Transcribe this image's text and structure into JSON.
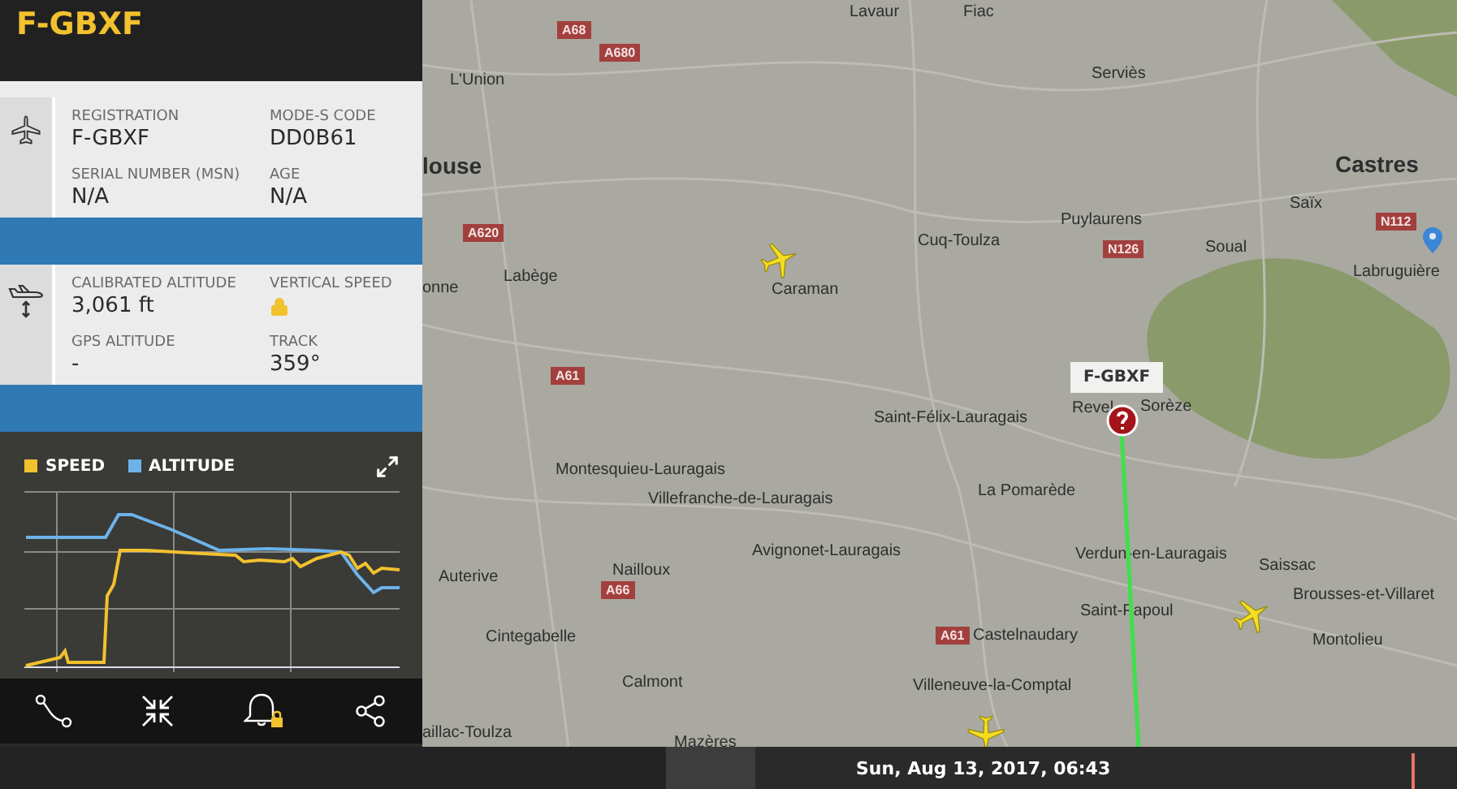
{
  "header": {
    "callsign": "F-GBXF"
  },
  "aircraft_section": {
    "fields": [
      {
        "label": "REGISTRATION",
        "kind": "text",
        "value": "F-GBXF"
      },
      {
        "label": "MODE-S CODE",
        "kind": "text",
        "value": "DD0B61"
      },
      {
        "label": "SERIAL NUMBER (MSN)",
        "kind": "text",
        "value": "N/A"
      },
      {
        "label": "AGE",
        "kind": "text",
        "value": "N/A"
      }
    ]
  },
  "altitude_section": {
    "fields": [
      {
        "label": "CALIBRATED ALTITUDE",
        "kind": "text",
        "value": "3,061 ft"
      },
      {
        "label": "VERTICAL SPEED",
        "kind": "locked"
      },
      {
        "label": "GPS ALTITUDE",
        "kind": "text",
        "value": "-"
      },
      {
        "label": "TRACK",
        "kind": "text",
        "value": "359°"
      }
    ]
  },
  "chart": {
    "legend": [
      {
        "name": "SPEED",
        "color": "#f2c12e"
      },
      {
        "name": "ALTITUDE",
        "color": "#6db3ea"
      }
    ]
  },
  "map": {
    "places": [
      "Lavaur",
      "Fiac",
      "L'Union",
      "Serviès",
      "Castres",
      "Saïx",
      "Labruguière",
      "louse",
      "Cuq-Toulza",
      "Puylaurens",
      "Soual",
      "Caraman",
      "Labège",
      "onne",
      "Revel",
      "Sorèze",
      "Saint-Félix-Lauragais",
      "Montesquieu-Lauragais",
      "Villefranche-de-Lauragais",
      "La Pomarède",
      "Avignonet-Lauragais",
      "Verdun-en-Lauragais",
      "Saissac",
      "Brousses-et-Villaret",
      "Auterive",
      "Nailloux",
      "Saint-Papoul",
      "Cintegabelle",
      "Castelnaudary",
      "Montolieu",
      "Calmont",
      "Villeneuve-la-Comptal",
      "aillac-Toulza",
      "Mazères"
    ],
    "roads": [
      "A68",
      "A680",
      "A620",
      "A61",
      "N126",
      "N112",
      "A66",
      "A61"
    ],
    "flight_label": "F-GBXF"
  },
  "timeline": {
    "date": "Sun, Aug 13, 2017, 06:43"
  }
}
